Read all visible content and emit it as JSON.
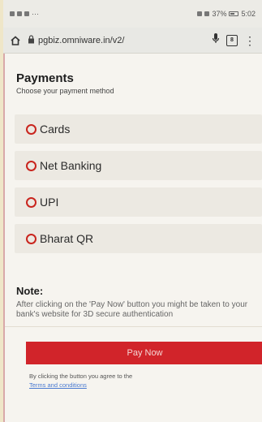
{
  "status_bar": {
    "left": "▤ ✉ ✪ ···",
    "right": "37%",
    "time": "5:02"
  },
  "browser": {
    "url": "pgbiz.omniware.in/v2/",
    "tabs_count": "8"
  },
  "page": {
    "title": "Payments",
    "subtitle": "Choose your payment method"
  },
  "methods": [
    {
      "label": "Cards"
    },
    {
      "label": "Net Banking"
    },
    {
      "label": "UPI"
    },
    {
      "label": "Bharat QR"
    }
  ],
  "note": {
    "title": "Note:",
    "text": "After clicking on the 'Pay Now' button you might be taken to your bank's website for 3D secure authentication"
  },
  "pay": {
    "button_label": "Pay Now",
    "agree_text": "By clicking the button you agree to the",
    "terms_link": "Terms and conditions"
  },
  "colors": {
    "accent": "#d1242a",
    "radio": "#c9251e",
    "link": "#4a7ad1"
  }
}
